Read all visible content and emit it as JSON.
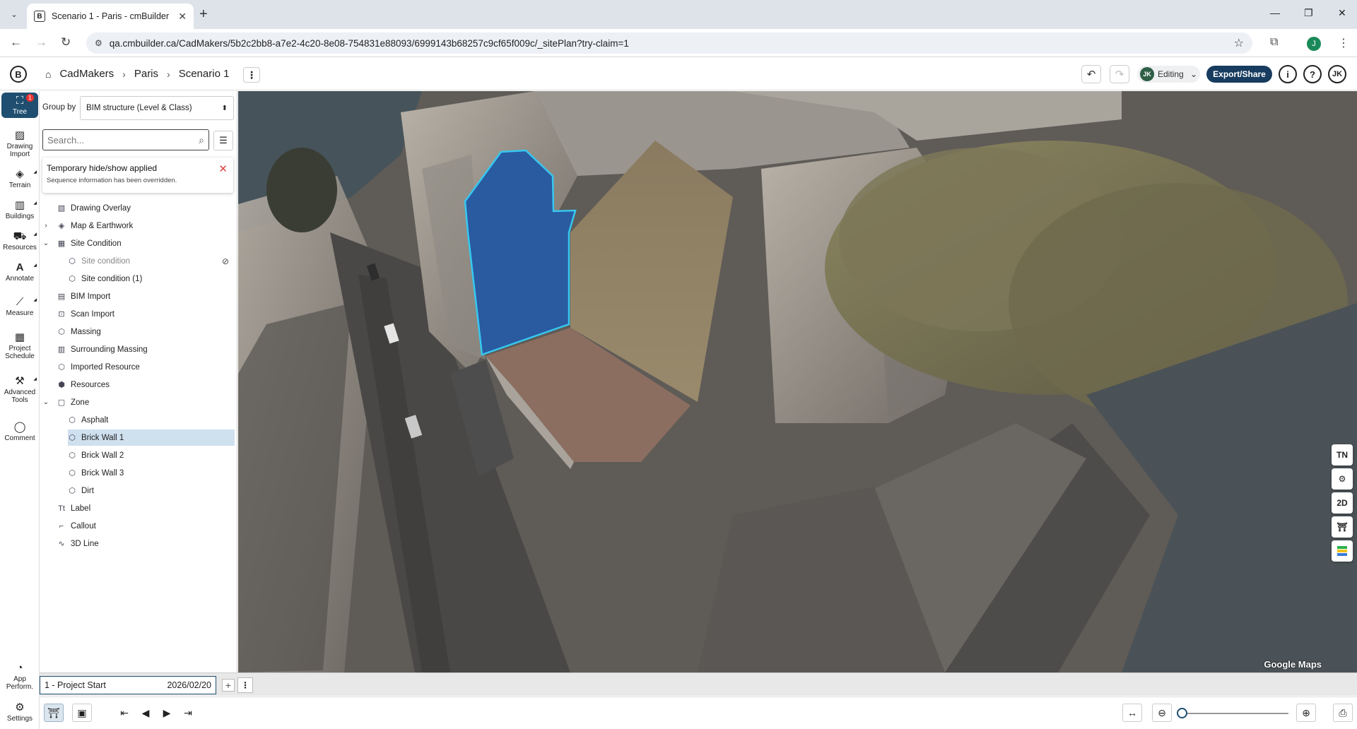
{
  "browser": {
    "tab_title": "Scenario 1 - Paris - cmBuilder",
    "url": "qa.cmbuilder.ca/CadMakers/5b2c2bb8-a7e2-4c20-8e08-754831e88093/6999143b68257c9cf65f009c/_sitePlan?try-claim=1",
    "profile_initial": "J"
  },
  "header": {
    "crumbs": [
      "CadMakers",
      "Paris",
      "Scenario 1"
    ],
    "editing_avatar": "JK",
    "editing_label": "Editing",
    "export_label": "Export/Share",
    "info_label": "i",
    "help_label": "?",
    "user_initials": "JK"
  },
  "rail": {
    "items": [
      {
        "label": "Tree",
        "icon": "tree-icon",
        "badge": "1"
      },
      {
        "label": "Drawing Import",
        "icon": "drawing-import-icon"
      },
      {
        "label": "Terrain",
        "icon": "terrain-icon"
      },
      {
        "label": "Buildings",
        "icon": "buildings-icon"
      },
      {
        "label": "Resources",
        "icon": "resources-icon"
      },
      {
        "label": "Annotate",
        "icon": "annotate-icon"
      },
      {
        "label": "Measure",
        "icon": "measure-icon"
      },
      {
        "label": "Project Schedule",
        "icon": "schedule-icon"
      },
      {
        "label": "Advanced Tools",
        "icon": "advanced-tools-icon"
      },
      {
        "label": "Comment",
        "icon": "comment-icon"
      }
    ],
    "bottom": [
      {
        "label": "App Perform.",
        "icon": "performance-icon"
      },
      {
        "label": "Settings",
        "icon": "settings-icon"
      }
    ]
  },
  "panel": {
    "group_by_label": "Group by",
    "group_by_value": "BIM structure (Level & Class)",
    "search_placeholder": "Search...",
    "notice_title": "Temporary hide/show applied",
    "notice_sub": "Sequence information has been overridden.",
    "tree": [
      {
        "label": "Drawing Overlay",
        "level": 0,
        "expand": "",
        "icon": "▧"
      },
      {
        "label": "Map & Earthwork",
        "level": 0,
        "expand": "›",
        "icon": "◈"
      },
      {
        "label": "Site Condition",
        "level": 0,
        "expand": "⌄",
        "icon": "▦"
      },
      {
        "label": "Site condition",
        "level": 1,
        "expand": "",
        "icon": "⬡",
        "dim": true,
        "hidden": true
      },
      {
        "label": "Site condition (1)",
        "level": 1,
        "expand": "",
        "icon": "⬡"
      },
      {
        "label": "BIM Import",
        "level": 0,
        "expand": "",
        "icon": "▤"
      },
      {
        "label": "Scan Import",
        "level": 0,
        "expand": "",
        "icon": "⊡"
      },
      {
        "label": "Massing",
        "level": 0,
        "expand": "",
        "icon": "⬡"
      },
      {
        "label": "Surrounding Massing",
        "level": 0,
        "expand": "",
        "icon": "▥"
      },
      {
        "label": "Imported Resource",
        "level": 0,
        "expand": "",
        "icon": "⬡"
      },
      {
        "label": "Resources",
        "level": 0,
        "expand": "",
        "icon": "⬢"
      },
      {
        "label": "Zone",
        "level": 0,
        "expand": "⌄",
        "icon": "▢"
      },
      {
        "label": "Asphalt",
        "level": 1,
        "expand": "",
        "icon": "⬡"
      },
      {
        "label": "Brick Wall 1",
        "level": 1,
        "expand": "",
        "icon": "⬡",
        "selected": true
      },
      {
        "label": "Brick Wall 2",
        "level": 1,
        "expand": "",
        "icon": "⬡"
      },
      {
        "label": "Brick Wall 3",
        "level": 1,
        "expand": "",
        "icon": "⬡"
      },
      {
        "label": "Dirt",
        "level": 1,
        "expand": "",
        "icon": "⬡"
      },
      {
        "label": "Label",
        "level": 0,
        "expand": "",
        "icon": "Tt"
      },
      {
        "label": "Callout",
        "level": 0,
        "expand": "",
        "icon": "⌐"
      },
      {
        "label": "3D Line",
        "level": 0,
        "expand": "",
        "icon": "∿"
      }
    ]
  },
  "viewport": {
    "right_tools": [
      {
        "name": "north-icon",
        "label": "TN"
      },
      {
        "name": "layers-icon",
        "label": "⚙"
      },
      {
        "name": "view-2d-button",
        "label": "2D"
      },
      {
        "name": "crane-icon",
        "label": "⛩"
      },
      {
        "name": "color-legend-icon",
        "label": "▤"
      }
    ],
    "attribution": "Google Maps"
  },
  "scenario": {
    "label": "1 - Project Start",
    "date": "2026/02/20"
  },
  "colors": {
    "accent": "#1f4e70",
    "selection": "#cfe0ef",
    "zone_blue": "#2a5aa0",
    "zone_outline": "#35c8f0"
  }
}
